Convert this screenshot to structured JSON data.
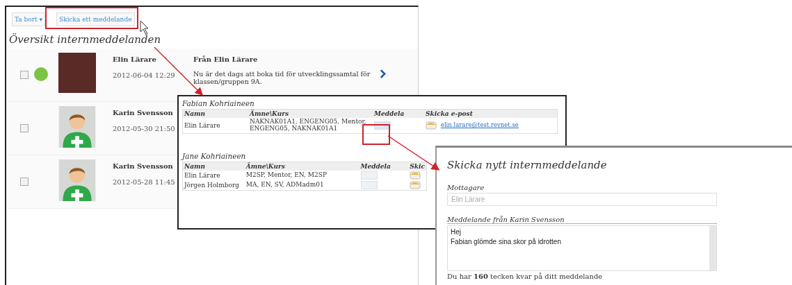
{
  "toolbar": {
    "delete_menu": {
      "label": "Ta bort",
      "caret": "▾"
    },
    "send_button": {
      "label": "Skicka ett meddelande"
    }
  },
  "heading": "Översikt internmeddelanden",
  "messages": [
    {
      "checked": false,
      "unread": true,
      "kind": "photo",
      "name": "Elin Lärare",
      "date": "2012-06-04 12:29",
      "subject": "Från Elin Lärare",
      "preview": "Nu är det dags att boka tid för utvecklingssamtal för klassen/gruppen 9A."
    },
    {
      "checked": false,
      "unread": false,
      "kind": "default",
      "name": "Karin Svensson",
      "date": "2012-05-30 21:50"
    },
    {
      "checked": false,
      "unread": false,
      "kind": "default",
      "name": "Karin Svensson",
      "date": "2012-05-28 11:45"
    }
  ],
  "contacts": {
    "groups": [
      {
        "student": "Fabian Kohriaineen",
        "columns": [
          "Namn",
          "Ämne\\Kurs",
          "Meddela",
          "Skicka e-post"
        ],
        "rows": [
          {
            "name": "Elin Lärare",
            "subjects": "NAKNAK01A1, ENGENG05, Mentor, ENGENG05, NAKNAK01A1",
            "email": "elin.larare@test.reynet.se",
            "highlighted": true
          }
        ]
      },
      {
        "student": "Jane Kohriaineen",
        "columns": [
          "Namn",
          "Ämne\\Kurs",
          "Meddela",
          "Skic"
        ],
        "rows": [
          {
            "name": "Elin Lärare",
            "subjects": "M2SP, Mentor, EN, M2SP",
            "highlighted": false
          },
          {
            "name": "Jörgen Holmborg",
            "subjects": "MA, EN, SV, ADMadm01",
            "highlighted": false
          }
        ]
      }
    ]
  },
  "dialog": {
    "title": "Skicka nytt internmeddelande",
    "recipient_label": "Mottagare",
    "recipient_value": "Elin Lärare",
    "message_label": "Meddelande från Karin Svensson",
    "message_lines": [
      "Hej",
      "Fabian glömde sina skor på idrotten"
    ],
    "counter": "Du har **160** tecken kvar på ditt meddelande"
  }
}
